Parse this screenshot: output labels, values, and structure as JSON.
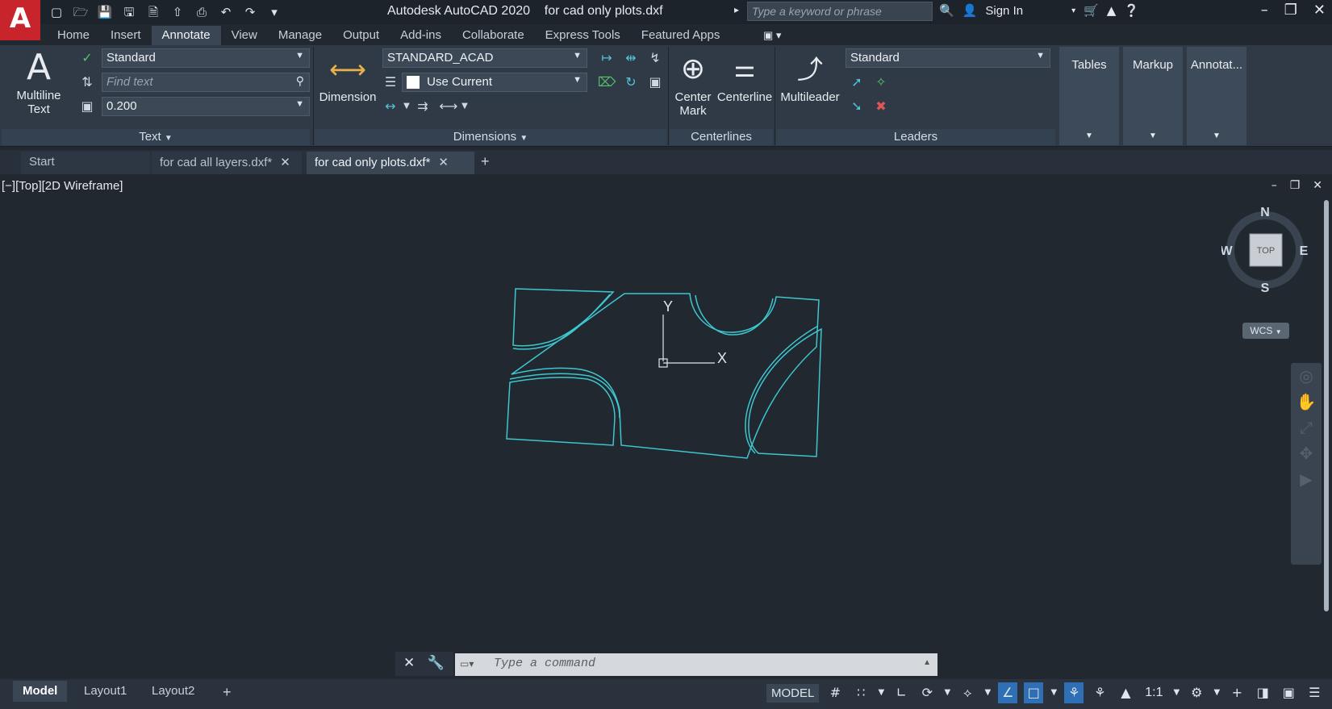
{
  "app": {
    "logo_letter": "A",
    "title": "Autodesk AutoCAD 2020    for cad only plots.dxf",
    "search_placeholder": "Type a keyword or phrase",
    "sign_in": "Sign In"
  },
  "ribbon_tabs": [
    "Home",
    "Insert",
    "Annotate",
    "View",
    "Manage",
    "Output",
    "Add-ins",
    "Collaborate",
    "Express Tools",
    "Featured Apps"
  ],
  "ribbon": {
    "text_panel": {
      "multiline_line1": "Multiline",
      "multiline_line2": "Text",
      "style_value": "Standard",
      "find_placeholder": "Find text",
      "height_value": "0.200",
      "title": "Text"
    },
    "dimensions_panel": {
      "dimension_label": "Dimension",
      "style_value": "STANDARD_ACAD",
      "layer_value": "Use Current",
      "title": "Dimensions"
    },
    "centerlines_panel": {
      "center_mark_line1": "Center",
      "center_mark_line2": "Mark",
      "centerline_label": "Centerline",
      "title": "Centerlines"
    },
    "leaders_panel": {
      "multileader_label": "Multileader",
      "style_value": "Standard",
      "title": "Leaders"
    },
    "tables_label": "Tables",
    "markup_label": "Markup",
    "annotation_label": "Annotat..."
  },
  "doc_tabs": [
    {
      "label": "Start"
    },
    {
      "label": "for cad all layers.dxf*"
    },
    {
      "label": "for cad only plots.dxf*"
    }
  ],
  "viewport": {
    "label": "[−][Top][2D Wireframe]",
    "ucs_y": "Y",
    "ucs_x": "X",
    "compass": {
      "n": "N",
      "s": "S",
      "e": "E",
      "w": "W",
      "top": "TOP"
    },
    "wcs": "WCS"
  },
  "command": {
    "placeholder": "Type a command"
  },
  "status": {
    "layout_tabs": [
      "Model",
      "Layout1",
      "Layout2"
    ],
    "model_label": "MODEL",
    "scale": "1:1"
  },
  "colors": {
    "accent_cyan": "#3ec6cf",
    "logo_red": "#c7242b"
  }
}
